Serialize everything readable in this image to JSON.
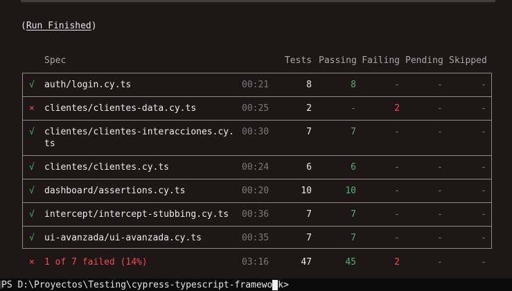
{
  "title": {
    "open": "(",
    "label": "Run Finished",
    "close": ")"
  },
  "headers": {
    "spec": "Spec",
    "tests": "Tests",
    "passing": "Passing",
    "failing": "Failing",
    "pending": "Pending",
    "skipped": "Skipped"
  },
  "rows": [
    {
      "status": "√",
      "spec": "auth/login.cy.ts",
      "spec2": "",
      "time": "00:21",
      "tests": "8",
      "passing": "8",
      "failing": "-",
      "pending": "-",
      "skipped": "-"
    },
    {
      "status": "×",
      "spec": "clientes/clientes-data.cy.ts",
      "spec2": "",
      "time": "00:25",
      "tests": "2",
      "passing": "-",
      "failing": "2",
      "pending": "-",
      "skipped": "-"
    },
    {
      "status": "√",
      "spec": "clientes/clientes-interacciones.cy.",
      "spec2": "ts",
      "time": "00:30",
      "tests": "7",
      "passing": "7",
      "failing": "-",
      "pending": "-",
      "skipped": "-"
    },
    {
      "status": "√",
      "spec": "clientes/clientes.cy.ts",
      "spec2": "",
      "time": "00:24",
      "tests": "6",
      "passing": "6",
      "failing": "-",
      "pending": "-",
      "skipped": "-"
    },
    {
      "status": "√",
      "spec": "dashboard/assertions.cy.ts",
      "spec2": "",
      "time": "00:20",
      "tests": "10",
      "passing": "10",
      "failing": "-",
      "pending": "-",
      "skipped": "-"
    },
    {
      "status": "√",
      "spec": "intercept/intercept-stubbing.cy.ts",
      "spec2": "",
      "time": "00:36",
      "tests": "7",
      "passing": "7",
      "failing": "-",
      "pending": "-",
      "skipped": "-"
    },
    {
      "status": "√",
      "spec": "ui-avanzada/ui-avanzada.cy.ts",
      "spec2": "",
      "time": "00:35",
      "tests": "7",
      "passing": "7",
      "failing": "-",
      "pending": "-",
      "skipped": "-"
    }
  ],
  "summary": {
    "status": "×",
    "label": "1 of 7 failed (14%)",
    "time": "03:16",
    "tests": "47",
    "passing": "45",
    "failing": "2",
    "pending": "-",
    "skipped": "-"
  },
  "prompt": {
    "text": "PS D:\\Proyectos\\Testing\\cypress-typescript-framework>"
  },
  "colors": {
    "pass": "#3fb950",
    "fail": "#f14c4c",
    "background": "#1e1617"
  }
}
